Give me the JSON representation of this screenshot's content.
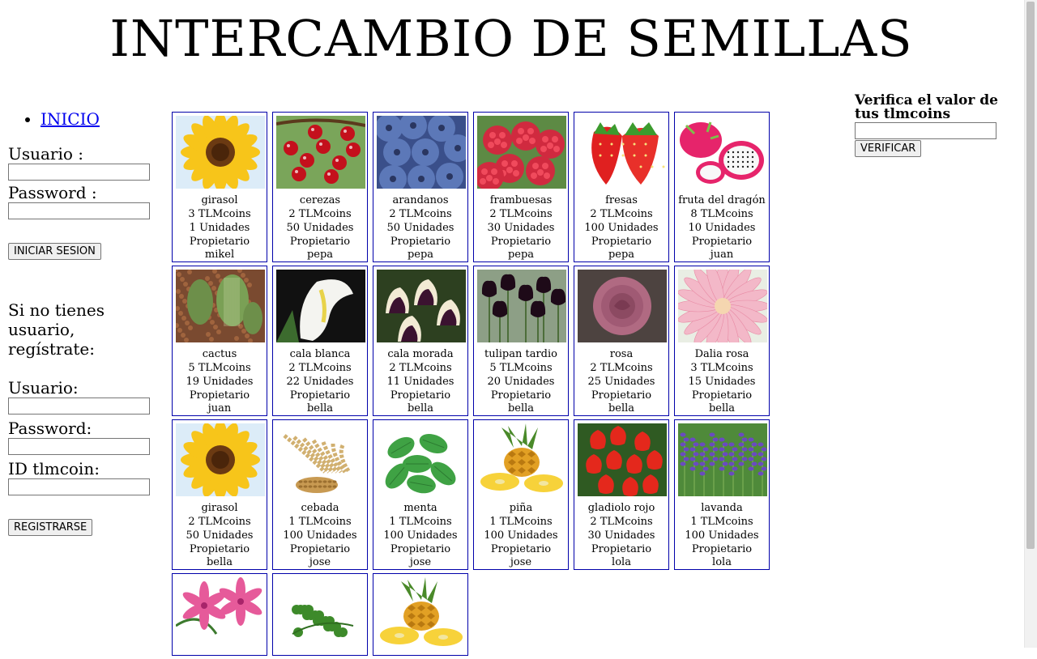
{
  "header": {
    "title": "INTERCAMBIO DE SEMILLAS"
  },
  "nav": {
    "items": [
      {
        "label": "INICIO"
      }
    ]
  },
  "login": {
    "user_label": "Usuario :",
    "password_label": "Password :",
    "user_value": "",
    "password_value": "",
    "submit_label": "INICIAR SESION"
  },
  "register": {
    "prompt": "Si no tienes usuario, regístrate:",
    "user_label": "Usuario:",
    "password_label": "Password:",
    "tlmcoin_label": "ID tlmcoin:",
    "submit_label": "REGISTRARSE"
  },
  "verify": {
    "title": "Verifica el valor de tus tlmcoins",
    "input_value": "",
    "submit_label": "VERIFICAR"
  },
  "products": [
    {
      "name": "girasol",
      "price": "3 TLMcoins",
      "units": "1 Unidades",
      "owner_label": "Propietario",
      "owner": "mikel",
      "image": "sunflower"
    },
    {
      "name": "cerezas",
      "price": "2 TLMcoins",
      "units": "50 Unidades",
      "owner_label": "Propietario",
      "owner": "pepa",
      "image": "cherries"
    },
    {
      "name": "arandanos",
      "price": "2 TLMcoins",
      "units": "50 Unidades",
      "owner_label": "Propietario",
      "owner": "pepa",
      "image": "blueberries"
    },
    {
      "name": "frambuesas",
      "price": "2 TLMcoins",
      "units": "30 Unidades",
      "owner_label": "Propietario",
      "owner": "pepa",
      "image": "raspberries"
    },
    {
      "name": "fresas",
      "price": "2 TLMcoins",
      "units": "100 Unidades",
      "owner_label": "Propietario",
      "owner": "pepa",
      "image": "strawberries"
    },
    {
      "name": "fruta del dragón",
      "price": "8 TLMcoins",
      "units": "10 Unidades",
      "owner_label": "Propietario",
      "owner": "juan",
      "image": "dragonfruit"
    },
    {
      "name": "cactus",
      "price": "5 TLMcoins",
      "units": "19 Unidades",
      "owner_label": "Propietario",
      "owner": "juan",
      "image": "cactus"
    },
    {
      "name": "cala blanca",
      "price": "2 TLMcoins",
      "units": "22 Unidades",
      "owner_label": "Propietario",
      "owner": "bella",
      "image": "white-calla"
    },
    {
      "name": "cala morada",
      "price": "2 TLMcoins",
      "units": "11 Unidades",
      "owner_label": "Propietario",
      "owner": "bella",
      "image": "purple-calla"
    },
    {
      "name": "tulipan tardio",
      "price": "5 TLMcoins",
      "units": "20 Unidades",
      "owner_label": "Propietario",
      "owner": "bella",
      "image": "dark-tulips"
    },
    {
      "name": "rosa",
      "price": "2 TLMcoins",
      "units": "25 Unidades",
      "owner_label": "Propietario",
      "owner": "bella",
      "image": "rose"
    },
    {
      "name": "Dalia rosa",
      "price": "3 TLMcoins",
      "units": "15 Unidades",
      "owner_label": "Propietario",
      "owner": "bella",
      "image": "dahlia"
    },
    {
      "name": "girasol",
      "price": "2 TLMcoins",
      "units": "50 Unidades",
      "owner_label": "Propietario",
      "owner": "bella",
      "image": "sunflower"
    },
    {
      "name": "cebada",
      "price": "1 TLMcoins",
      "units": "100 Unidades",
      "owner_label": "Propietario",
      "owner": "jose",
      "image": "barley"
    },
    {
      "name": "menta",
      "price": "1 TLMcoins",
      "units": "100 Unidades",
      "owner_label": "Propietario",
      "owner": "jose",
      "image": "mint"
    },
    {
      "name": "piña",
      "price": "1 TLMcoins",
      "units": "100 Unidades",
      "owner_label": "Propietario",
      "owner": "jose",
      "image": "pineapple"
    },
    {
      "name": "gladiolo rojo",
      "price": "2 TLMcoins",
      "units": "30 Unidades",
      "owner_label": "Propietario",
      "owner": "lola",
      "image": "red-gladiolus"
    },
    {
      "name": "lavanda",
      "price": "1 TLMcoins",
      "units": "100 Unidades",
      "owner_label": "Propietario",
      "owner": "lola",
      "image": "lavender"
    },
    {
      "image": "pink-lily"
    },
    {
      "image": "parsley"
    },
    {
      "image": "pineapple"
    }
  ]
}
